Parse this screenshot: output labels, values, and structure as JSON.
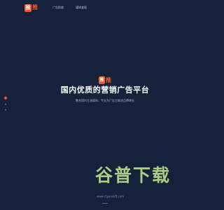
{
  "header": {
    "logo_glyph": "推",
    "logo_text": "推",
    "nav": [
      {
        "label": "广告投放"
      },
      {
        "label": "媒体变现"
      }
    ]
  },
  "pager": {
    "count": 3,
    "active_index": 0
  },
  "hero": {
    "logo_glyph": "推",
    "logo_text": "推",
    "title": "国内优质的营销广告平台",
    "subtitle": "整合国内主流媒体，专业为广告主推进品牌增长"
  },
  "watermark": {
    "text": "谷普下载",
    "url": "www.ctyunsoft.com"
  },
  "colors": {
    "background": "#16213b",
    "accent": "#f45a2a",
    "text_primary": "#ffffff",
    "text_secondary": "#aab3cc",
    "watermark": "#b9dc8a"
  }
}
